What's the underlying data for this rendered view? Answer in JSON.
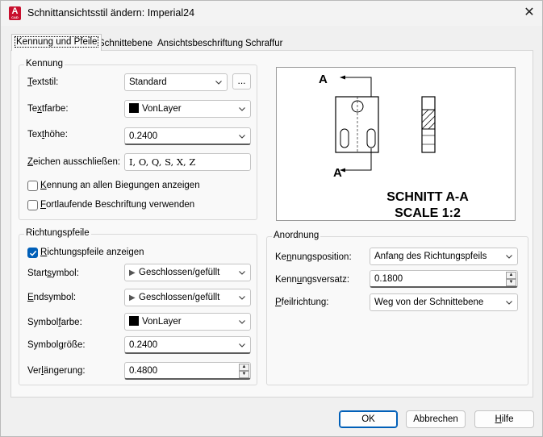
{
  "window": {
    "title": "Schnittansichtsstil ändern: Imperial24",
    "close_glyph": "✕",
    "app_icon_letter": "A",
    "app_icon_sub": "CAD"
  },
  "tabs": [
    {
      "label": "Kennung und Pfeile",
      "active": true
    },
    {
      "label": "Schnittebene",
      "active": false
    },
    {
      "label": "Ansichtsbeschriftung",
      "active": false
    },
    {
      "label": "Schraffur",
      "active": false
    }
  ],
  "kennung": {
    "group_title": "Kennung",
    "textstil": {
      "label_u": "T",
      "label_rest": "extstil:",
      "value": "Standard",
      "browse": "..."
    },
    "textfarbe": {
      "label_pre": "Te",
      "label_u": "x",
      "label_rest": "tfarbe:",
      "value": "VonLayer",
      "swatch": "#000000"
    },
    "texthoehe": {
      "label_pre": "Tex",
      "label_u": "t",
      "label_rest": "höhe:",
      "value": "0.2400"
    },
    "zeichen": {
      "label_u": "Z",
      "label_rest": "eichen ausschließen:",
      "value": "I, O, Q, S, X, Z"
    },
    "cb_biegungen": {
      "label_u": "K",
      "label_rest": "ennung an allen Biegungen anzeigen",
      "checked": false
    },
    "cb_fortlaufend": {
      "label_u": "F",
      "label_rest": "ortlaufende Beschriftung verwenden",
      "checked": false
    }
  },
  "richtungspfeile": {
    "group_title": "Richtungspfeile",
    "cb_anzeigen": {
      "label_u": "R",
      "label_rest": "ichtungspfeile anzeigen",
      "checked": true
    },
    "startsymbol": {
      "label_pre": "Start",
      "label_u": "s",
      "label_rest": "ymbol:",
      "value": "Geschlossen/gefüllt",
      "icon": "▶"
    },
    "endsymbol": {
      "label_u": "E",
      "label_rest": "ndsymbol:",
      "value": "Geschlossen/gefüllt",
      "icon": "▶"
    },
    "symbolfarbe": {
      "label_pre": "Symbol",
      "label_u": "f",
      "label_rest": "arbe:",
      "value": "VonLayer",
      "swatch": "#000000"
    },
    "symbolgroesse": {
      "label_pre": "Symbol",
      "label_u": "g",
      "label_rest": "röße:",
      "value": "0.2400"
    },
    "verlaengerung": {
      "label_pre": "Ver",
      "label_u": "l",
      "label_rest": "ängerung:",
      "value": "0.4800"
    }
  },
  "preview": {
    "arrow_label_top": "A",
    "arrow_label_bottom": "A",
    "caption_line1": "SCHNITT A-A",
    "caption_line2": "SCALE 1:2"
  },
  "anordnung": {
    "group_title": "Anordnung",
    "position": {
      "label_pre": "Ke",
      "label_u": "n",
      "label_rest": "nungsposition:",
      "value": "Anfang des Richtungspfeils"
    },
    "versatz": {
      "label_pre": "Kenn",
      "label_u": "u",
      "label_rest": "ngsversatz:",
      "value": "0.1800"
    },
    "richtung": {
      "label_u": "P",
      "label_rest": "feilrichtung:",
      "value": "Weg von der Schnittebene"
    }
  },
  "buttons": {
    "ok": "OK",
    "cancel": "Abbrechen",
    "help_u": "H",
    "help_rest": "ilfe"
  }
}
